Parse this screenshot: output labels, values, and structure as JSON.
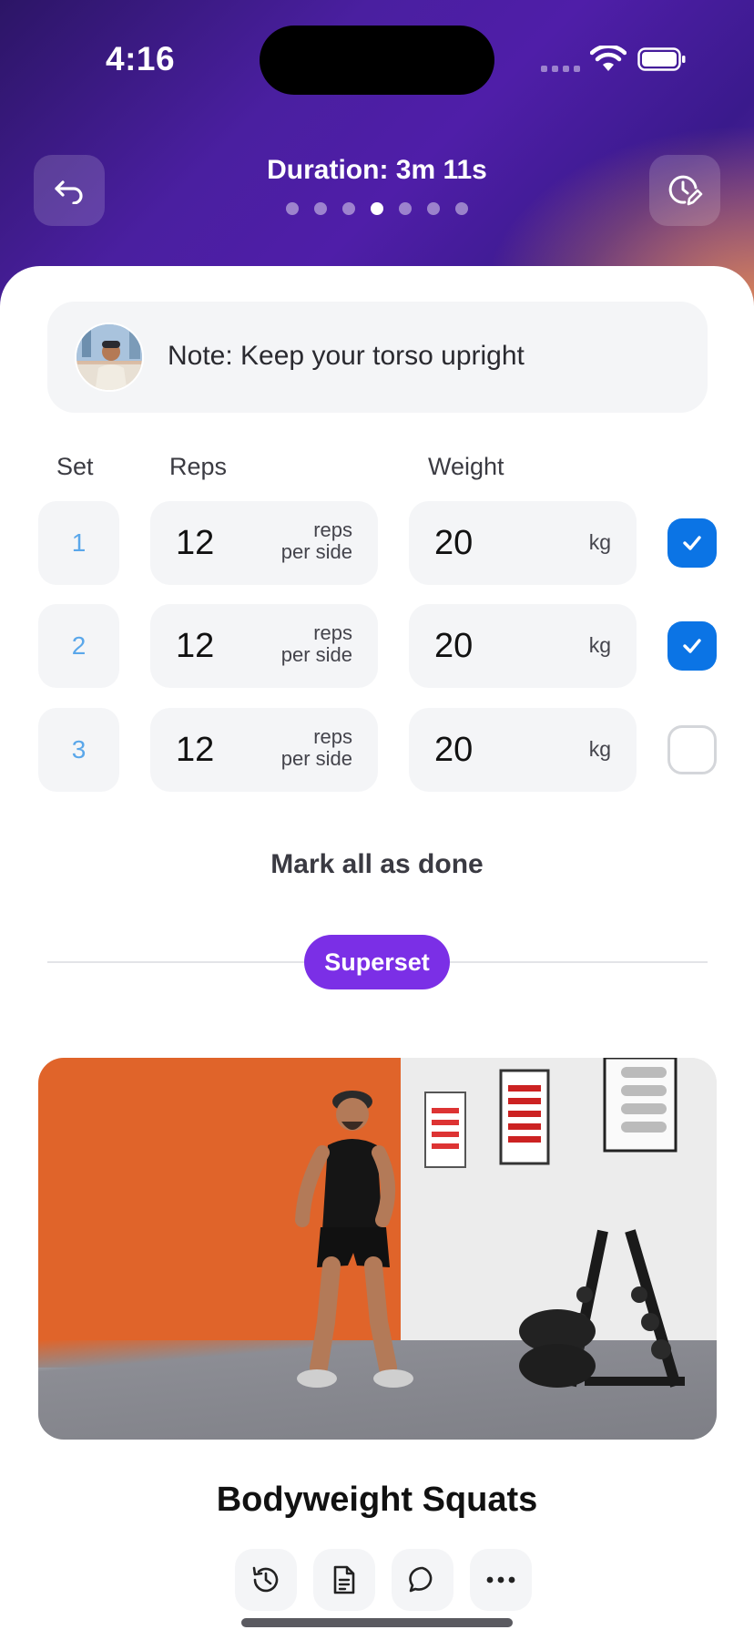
{
  "status_bar": {
    "time": "4:16"
  },
  "header": {
    "duration_label": "Duration: 3m 11s",
    "page_count": 7,
    "active_page": 4
  },
  "note": {
    "text": "Note: Keep your torso upright"
  },
  "columns": {
    "set": "Set",
    "reps": "Reps",
    "weight": "Weight"
  },
  "sets": [
    {
      "number": "1",
      "reps": "12",
      "reps_unit_line1": "reps",
      "reps_unit_line2": "per side",
      "weight": "20",
      "weight_unit": "kg",
      "done": true
    },
    {
      "number": "2",
      "reps": "12",
      "reps_unit_line1": "reps",
      "reps_unit_line2": "per side",
      "weight": "20",
      "weight_unit": "kg",
      "done": true
    },
    {
      "number": "3",
      "reps": "12",
      "reps_unit_line1": "reps",
      "reps_unit_line2": "per side",
      "weight": "20",
      "weight_unit": "kg",
      "done": false
    }
  ],
  "mark_all_label": "Mark all as done",
  "superset_label": "Superset",
  "exercise": {
    "title": "Bodyweight Squats"
  },
  "actions": [
    "history-icon",
    "notes-icon",
    "comment-icon",
    "more-icon"
  ],
  "colors": {
    "accent": "#7b2fe6",
    "check": "#0b74e5",
    "set_number": "#5aa7ea"
  }
}
